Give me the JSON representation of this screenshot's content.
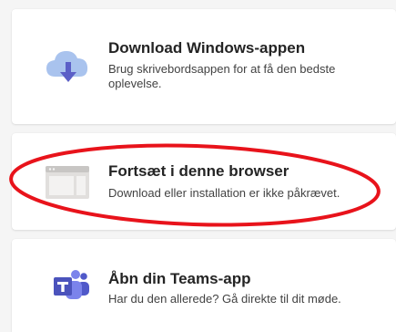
{
  "options": [
    {
      "id": "download",
      "icon": "cloud-download-icon",
      "title": "Download Windows-appen",
      "description": "Brug skrivebordsappen for at få den bedste oplevelse."
    },
    {
      "id": "browser",
      "icon": "browser-window-icon",
      "title": "Fortsæt i denne browser",
      "description": "Download eller installation er ikke påkrævet."
    },
    {
      "id": "teams",
      "icon": "teams-icon",
      "title": "Åbn din Teams-app",
      "description": "Har du den allerede? Gå direkte til dit møde."
    }
  ],
  "colors": {
    "annotation": "#e8131b",
    "teams_purple": "#5b5fc7",
    "cloud_blue": "#a9c3ee",
    "arrow_purple": "#5b5fc7"
  }
}
